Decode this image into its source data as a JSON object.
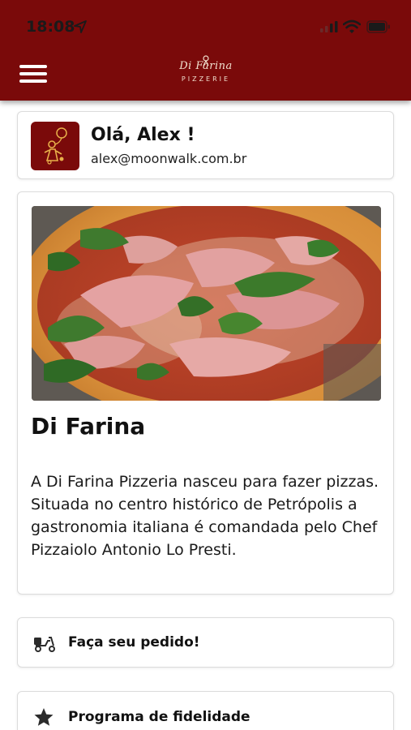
{
  "status_bar": {
    "time": "18:08"
  },
  "header": {
    "logo": {
      "line1": "Di Farina",
      "line2": "PIZZERIE"
    },
    "background_color": "#7a0a0a"
  },
  "user": {
    "greeting": "Olá, Alex !",
    "email": "alex@moonwalk.com.br"
  },
  "about": {
    "title": "Di Farina",
    "description": "A Di Farina Pizzeria nasceu para fazer pizzas. Situada no centro histórico de Petrópolis a gastronomia italiana é comandada pelo Chef Pizzaiolo Antonio Lo Presti."
  },
  "actions": {
    "order": {
      "label": "Faça seu pedido!",
      "icon": "delivery-scooter-icon"
    },
    "loyalty": {
      "label": "Programa de fidelidade",
      "icon": "star-icon"
    }
  }
}
